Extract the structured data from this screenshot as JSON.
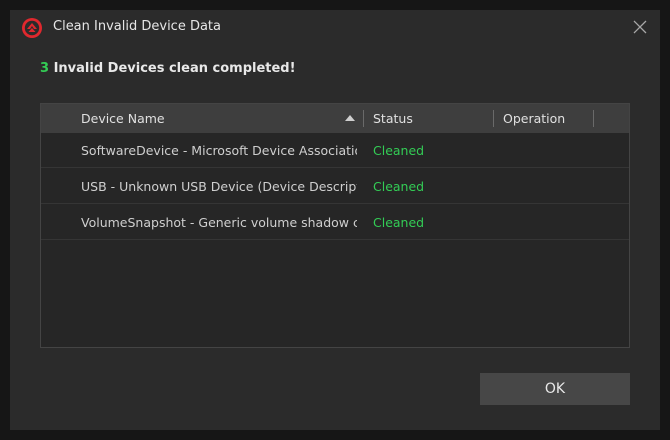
{
  "dialog": {
    "title": "Clean Invalid Device Data",
    "summary_count": "3",
    "summary_text": " Invalid Devices clean completed!",
    "ok_label": "OK"
  },
  "table": {
    "headers": {
      "device_name": "Device Name",
      "status": "Status",
      "operation": "Operation"
    },
    "rows": [
      {
        "device": "SoftwareDevice - Microsoft Device Associatio...",
        "status": "Cleaned",
        "operation": ""
      },
      {
        "device": "USB - Unknown USB Device (Device Descripto...",
        "status": "Cleaned",
        "operation": ""
      },
      {
        "device": "VolumeSnapshot - Generic volume shadow co...",
        "status": "Cleaned",
        "operation": ""
      }
    ]
  },
  "colors": {
    "accent_green": "#33cc55",
    "logo_red": "#e0282e"
  },
  "icons": {
    "app_logo": "driver-booster-logo-icon",
    "close": "close-icon",
    "sort": "sort-ascending-icon"
  }
}
